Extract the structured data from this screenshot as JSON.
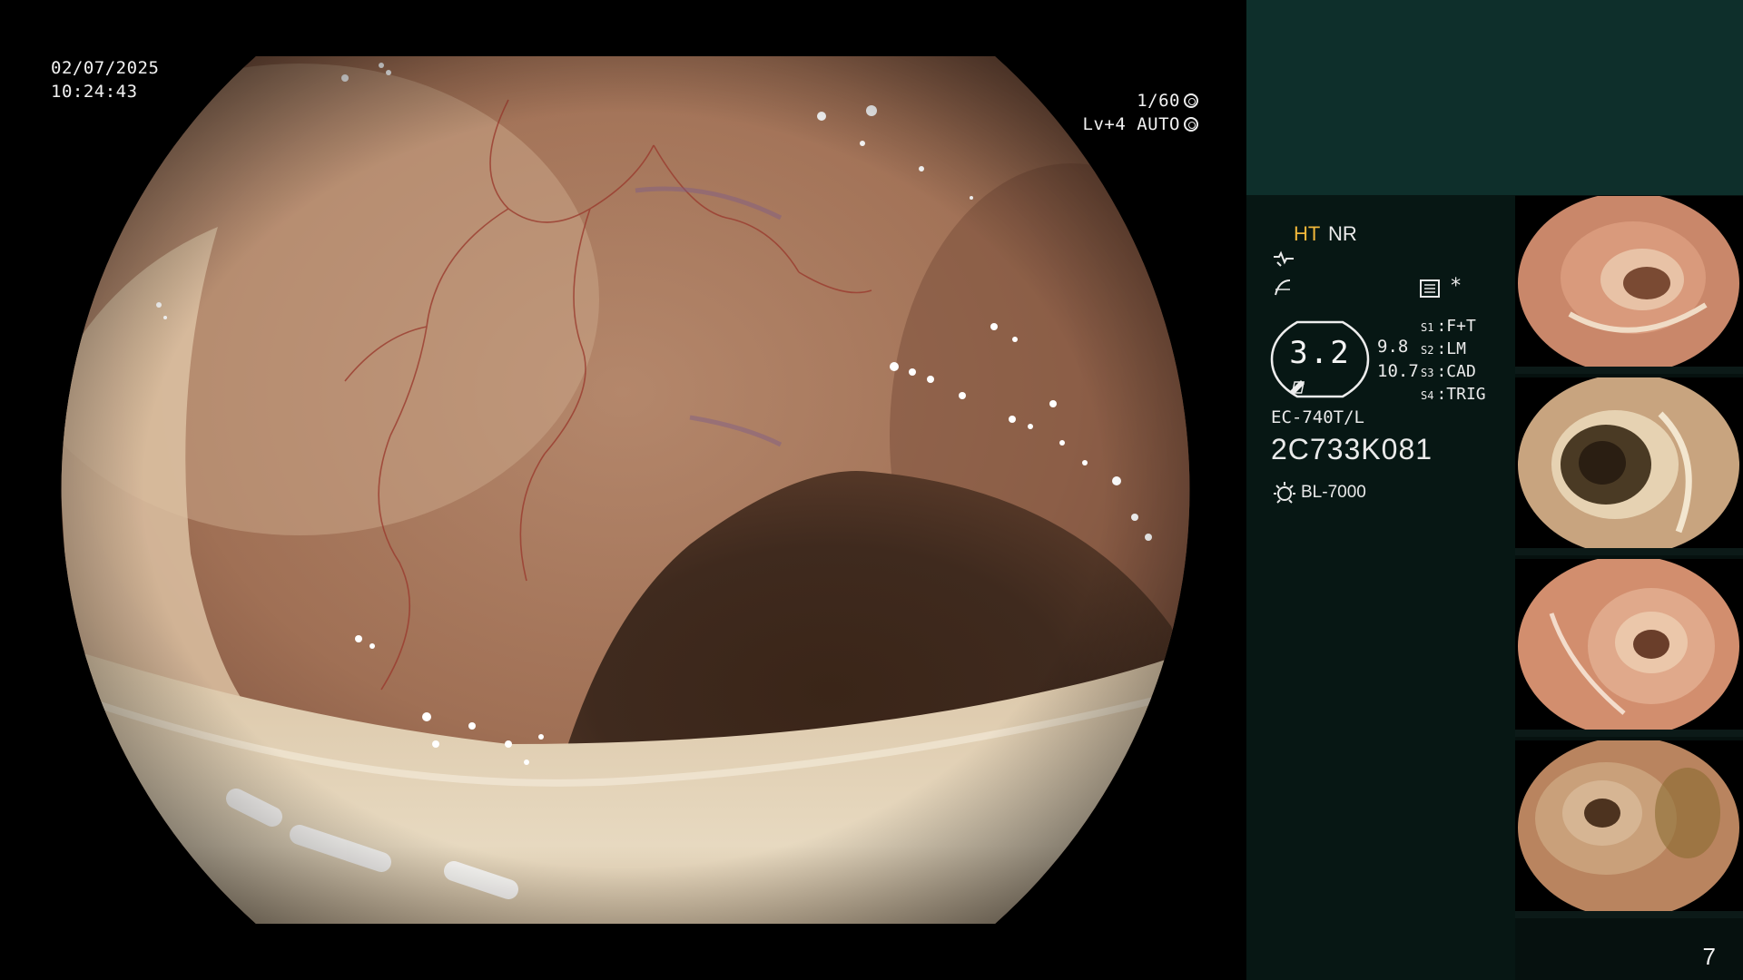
{
  "hud": {
    "date": "02/07/2025",
    "time": "10:24:43",
    "shutter": "1/60",
    "level": "Lv+4 AUTO"
  },
  "panel": {
    "mode_ht": "HT",
    "mode_nr": "NR",
    "star": "*",
    "oval_value": "3.2",
    "side_value_1": "9.8",
    "side_value_2": "10.7",
    "switches": [
      {
        "key": "S1",
        "value": "F+T"
      },
      {
        "key": "S2",
        "value": "LM"
      },
      {
        "key": "S3",
        "value": "CAD"
      },
      {
        "key": "S4",
        "value": "TRIG"
      }
    ],
    "scope_model": "EC-740T/L",
    "scope_serial": "2C733K081",
    "light_source": "BL-7000",
    "page_number": "7"
  },
  "icons": {
    "shutter": "aperture-icon",
    "level": "auto-iris-icon",
    "curve1": "enhance-curve-icon",
    "curve2": "tone-curve-icon",
    "record": "record-list-icon",
    "light": "light-source-icon"
  },
  "colors": {
    "panel_bg": "#06110f",
    "panel_top": "#0e2f2b",
    "ht_accent": "#f0b73a",
    "mucosa": "#b07a5c"
  }
}
